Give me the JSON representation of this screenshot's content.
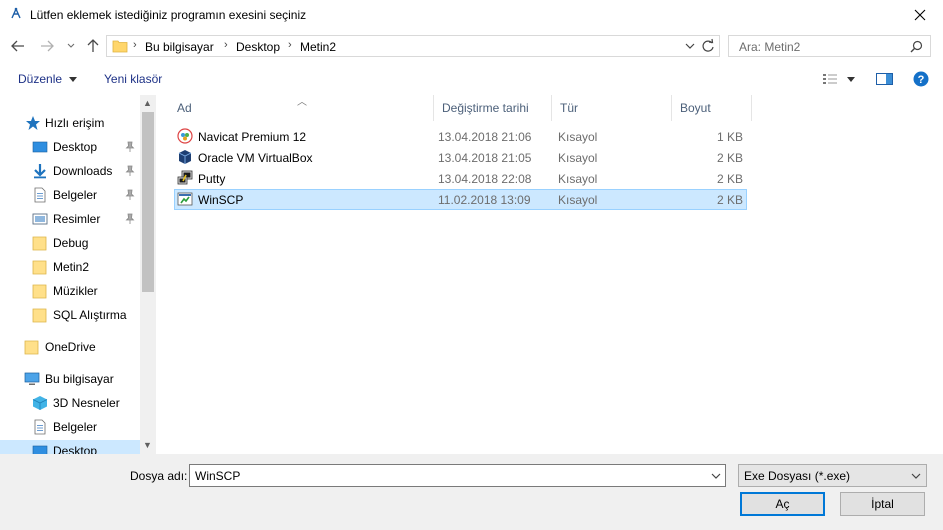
{
  "window": {
    "title": "Lütfen eklemek istediğiniz programın exesini seçiniz",
    "close_glyph": "✕"
  },
  "address": {
    "crumbs": [
      "Bu bilgisayar",
      "Desktop",
      "Metin2"
    ],
    "separator": "›"
  },
  "search": {
    "placeholder": "Ara: Metin2"
  },
  "commandbar": {
    "organize": "Düzenle",
    "new_folder": "Yeni klasör"
  },
  "navpane": {
    "quick_access": "Hızlı erişim",
    "items": [
      {
        "label": "Desktop",
        "icon": "desktop-folder-icon",
        "pinned": true
      },
      {
        "label": "Downloads",
        "icon": "downloads-icon",
        "pinned": true
      },
      {
        "label": "Belgeler",
        "icon": "documents-icon",
        "pinned": true
      },
      {
        "label": "Resimler",
        "icon": "pictures-icon",
        "pinned": true
      },
      {
        "label": "Debug",
        "icon": "folder-icon",
        "pinned": false
      },
      {
        "label": "Metin2",
        "icon": "folder-icon",
        "pinned": false
      },
      {
        "label": "Müzikler",
        "icon": "folder-icon",
        "pinned": false
      },
      {
        "label": "SQL Alıştırma",
        "icon": "folder-icon",
        "pinned": false
      }
    ],
    "onedrive": "OneDrive",
    "this_pc": "Bu bilgisayar",
    "pc_items": [
      {
        "label": "3D Nesneler",
        "icon": "3d-objects-icon"
      },
      {
        "label": "Belgeler",
        "icon": "documents-icon"
      },
      {
        "label": "Desktop",
        "icon": "desktop-folder-icon"
      }
    ]
  },
  "filelist": {
    "columns": [
      "Ad",
      "Değiştirme tarihi",
      "Tür",
      "Boyut"
    ],
    "rows": [
      {
        "name": "Navicat Premium 12",
        "date": "13.04.2018 21:06",
        "type": "Kısayol",
        "size": "1 KB",
        "icon": "navicat-icon"
      },
      {
        "name": "Oracle VM VirtualBox",
        "date": "13.04.2018 21:05",
        "type": "Kısayol",
        "size": "2 KB",
        "icon": "virtualbox-icon"
      },
      {
        "name": "Putty",
        "date": "13.04.2018 22:08",
        "type": "Kısayol",
        "size": "2 KB",
        "icon": "putty-icon"
      },
      {
        "name": "WinSCP",
        "date": "11.02.2018 13:09",
        "type": "Kısayol",
        "size": "2 KB",
        "icon": "winscp-icon",
        "selected": true
      }
    ]
  },
  "bottom": {
    "filename_label": "Dosya adı:",
    "filename_value": "WinSCP",
    "filetype_value": "Exe Dosyası  (*.exe)",
    "open_button": "Aç",
    "cancel_button": "İptal"
  },
  "colors": {
    "selection_bg": "#cce8ff",
    "selection_border": "#99d1ff",
    "accent": "#0078d7",
    "header_text": "#4c607a",
    "link_text": "#1e3287"
  }
}
